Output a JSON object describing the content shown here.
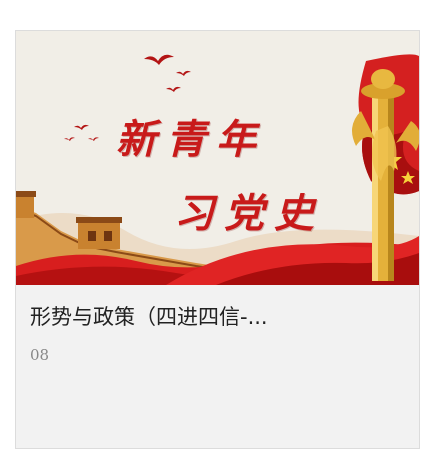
{
  "course_card": {
    "cover": {
      "line1": "新青年",
      "line2": "习党史"
    },
    "title": "形势与政策（四进四信-...",
    "meta": "08"
  },
  "colors": {
    "card_bg": "#f2f2f2",
    "card_border": "#dcdcdc",
    "cover_red": "#c81a1a",
    "title_text": "#222222",
    "meta_text": "#888888"
  },
  "icons": [
    "birds-icon",
    "great-wall-illustration",
    "huabiao-column-illustration",
    "red-flag-illustration"
  ]
}
